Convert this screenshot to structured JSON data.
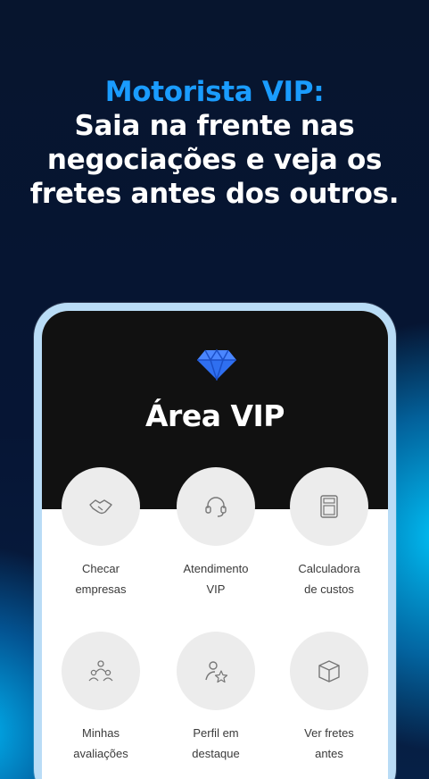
{
  "headline": {
    "accent": "Motorista VIP:",
    "lines": [
      "Saia na frente nas",
      "negociações e veja os",
      "fretes antes dos outros."
    ]
  },
  "screen": {
    "title": "Área VIP",
    "diamond_icon": "diamond-icon",
    "tiles": [
      {
        "label": "Checar\nempresas",
        "icon": "handshake-icon"
      },
      {
        "label": "Atendimento\nVIP",
        "icon": "headset-icon"
      },
      {
        "label": "Calculadora\nde custos",
        "icon": "calculator-icon"
      },
      {
        "label": "Minhas\navaliações",
        "icon": "people-rating-icon"
      },
      {
        "label": "Perfil em\ndestaque",
        "icon": "profile-star-icon"
      },
      {
        "label": "Ver fretes\nantes",
        "icon": "box-icon"
      }
    ]
  },
  "colors": {
    "background": "#061534",
    "accent": "#1a9cff",
    "glow": "#00c8ff",
    "phone_frame": "#b9dcf6",
    "diamond": "#2f6ff0"
  }
}
